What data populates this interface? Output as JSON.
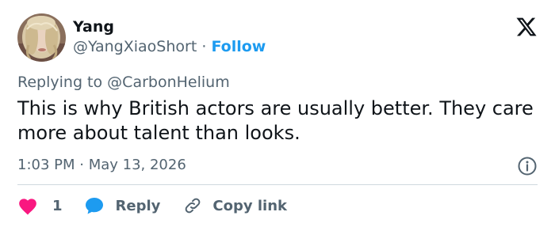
{
  "author": {
    "name": "Yang",
    "handle": "@YangXiaoShort",
    "separator": "·",
    "follow_label": "Follow",
    "avatar_icon": "avatar-photo"
  },
  "reply_context": {
    "prefix": "Replying to",
    "mention": "@CarbonHelium"
  },
  "tweet": {
    "text": "This is why British actors are usually better. They care more about talent than looks.",
    "timestamp": "1:03 PM · May 13, 2026"
  },
  "actions": {
    "like_count": "1",
    "reply_label": "Reply",
    "copy_link_label": "Copy link"
  },
  "icons": {
    "brand": "x-logo-icon",
    "info": "info-icon",
    "like": "heart-icon",
    "reply": "speech-bubble-icon",
    "copy": "link-icon"
  },
  "colors": {
    "accent": "#1d9bf0",
    "like": "#f91880",
    "text_primary": "#0f1419",
    "text_secondary": "#536471",
    "divider": "#cfd9de"
  }
}
